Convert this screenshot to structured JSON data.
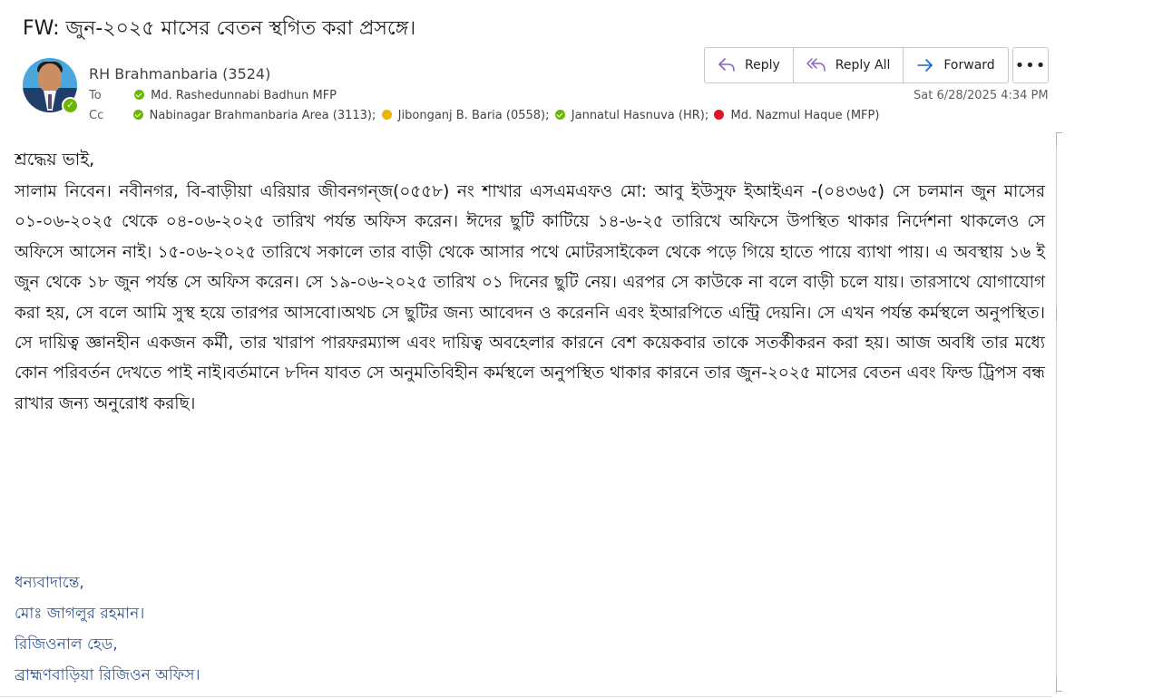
{
  "email": {
    "subject": "FW: জুন-২০২৫ মাসের বেতন স্থগিত করা প্রসঙ্গে।",
    "sender": "RH Brahmanbaria (3524)",
    "to_label": "To",
    "cc_label": "Cc",
    "to": [
      {
        "name": "Md. Rashedunnabi Badhun MFP",
        "status_color": "#6bb700"
      }
    ],
    "cc": [
      {
        "name": "Nabinagar Brahmanbaria Area (3113);",
        "status_color": "#6bb700"
      },
      {
        "name": "Jibonganj B. Baria (0558);",
        "status_color": "#e8b600"
      },
      {
        "name": "Jannatul Hasnuva (HR);",
        "status_color": "#6bb700"
      },
      {
        "name": "Md. Nazmul Haque (MFP)",
        "status_color": "#e81123"
      }
    ],
    "timestamp": "Sat 6/28/2025 4:34 PM"
  },
  "actions": {
    "reply": "Reply",
    "reply_all": "Reply All",
    "forward": "Forward",
    "more": "•••"
  },
  "body": {
    "salutation": "শ্রদ্ধেয় ভাই,",
    "paragraph": "সালাম নিবেন। নবীনগর, বি-বাড়ীয়া এরিয়ার জীবনগন্জ(০৫৫৮) নং শাখার এসএমএফও মো: আবু ইউসুফ ইআইএন -(০৪৩৬৫) সে চলমান জুন মাসের ০১-০৬-২০২৫ থেকে ০৪-০৬-২০২৫ তারিখ পর্যন্ত অফিস করেন। ঈদের ছুটি কাটিয়ে ১৪-৬-২৫ তারিখে অফিসে উপস্থিত থাকার নির্দেশনা থাকলেও সে অফিসে আসেন নাই। ১৫-০৬-২০২৫ তারিখে সকালে তার বাড়ী থেকে আসার পথে মোটরসাইকেল থেকে পড়ে গিয়ে হাতে পায়ে ব্যাথা পায়। এ অবস্থায় ১৬ ই জুন থেকে ১৮ জুন পর্যন্ত সে অফিস করেন। সে ১৯-০৬-২০২৫ তারিখ ০১ দিনের ছুটি নেয়। এরপর সে কাউকে না বলে বাড়ী চলে যায়। তারসাথে যোগাযোগ করা হয়, সে বলে আমি সুস্থ হয়ে তারপর আসবো।অথচ সে ছুটির জন্য আবেদন ও করেননি এবং ইআরপিতে এন্ট্রি দেয়নি। সে এখন পর্যন্ত কর্মস্থলে অনুপস্থিত। সে দায়িত্ব জ্ঞানহীন একজন কর্মী, তার খারাপ পারফরম্যান্স এবং দায়িত্ব অবহেলার কারনে বেশ কয়েকবার তাকে সতর্কীকরন করা হয়। আজ অবধি তার মধ্যে কোন পরিবর্তন দেখতে পাই নাই।বর্তমানে ৮দিন যাবত সে অনুমতিবিহীন কর্মস্থলে অনুপস্থিত থাকার কারনে তার জুন-২০২৫ মাসের বেতন এবং ফিল্ড ট্রিপস বন্ধ রাখার জন্য অনুরোধ করছি।"
  },
  "signature": {
    "closing": "ধন্যবাদান্তে,",
    "name": "মোঃ জাগলুর রহমান।",
    "title": "রিজিওনাল হেড,",
    "office": "ব্রাহ্মণবাড়িয়া রিজিওন অফিস।"
  }
}
